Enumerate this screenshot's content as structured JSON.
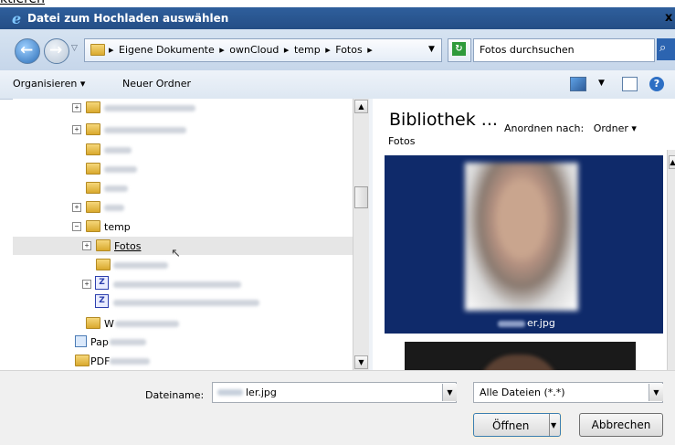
{
  "top_fragment": "ktieren",
  "title": {
    "text": "Datei zum Hochladen auswählen",
    "close": "x"
  },
  "breadcrumbs": [
    "Eigene Dokumente",
    "ownCloud",
    "temp",
    "Fotos"
  ],
  "search_placeholder": "Fotos durchsuchen",
  "command_bar": {
    "organize": "Organisieren",
    "new_folder": "Neuer Ordner"
  },
  "tree": {
    "temp": "temp",
    "fotos": "Fotos",
    "partial1": "W",
    "partial2": "Pap",
    "partial3": "PDF"
  },
  "library": {
    "title": "Bibliothek ...",
    "subtitle": "Fotos",
    "arrange_label": "Anordnen nach:",
    "arrange_value": "Ordner"
  },
  "file_card": {
    "name_suffix": "er.jpg"
  },
  "bottom": {
    "filename_label": "Dateiname:",
    "filename_value": "ler.jpg",
    "filter_value": "Alle Dateien (*.*)",
    "open_label": "Öffnen",
    "cancel_label": "Abbrechen"
  },
  "icons": {
    "back": "back-arrow-icon",
    "forward": "forward-arrow-icon",
    "refresh": "refresh-icon",
    "search": "magnifier-icon",
    "help": "help-icon"
  }
}
